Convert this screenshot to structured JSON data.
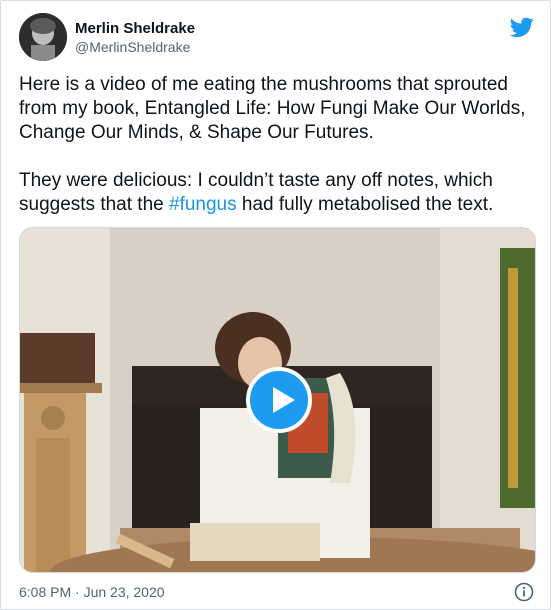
{
  "author": {
    "display_name": "Merlin Sheldrake",
    "handle": "@MerlinSheldrake"
  },
  "tweet": {
    "paragraph1": "Here is a video of me eating the mushrooms that sprouted from my book, Entangled Life: How Fungi Make Our Worlds, Change Our Minds, & Shape Our Futures.",
    "paragraph2_before": "They were delicious: I couldn’t taste any off notes, which suggests that the ",
    "hashtag": "#fungus",
    "paragraph2_after": " had fully metabolised the text."
  },
  "footer": {
    "timestamp": "6:08 PM · Jun 23, 2020"
  },
  "icons": {
    "brand": "twitter-bird-icon",
    "play": "play-icon",
    "info": "info-icon"
  },
  "colors": {
    "accent": "#1d9bf0",
    "hashtag": "#1b95e0",
    "text": "#0f1419",
    "secondary": "#536471"
  }
}
